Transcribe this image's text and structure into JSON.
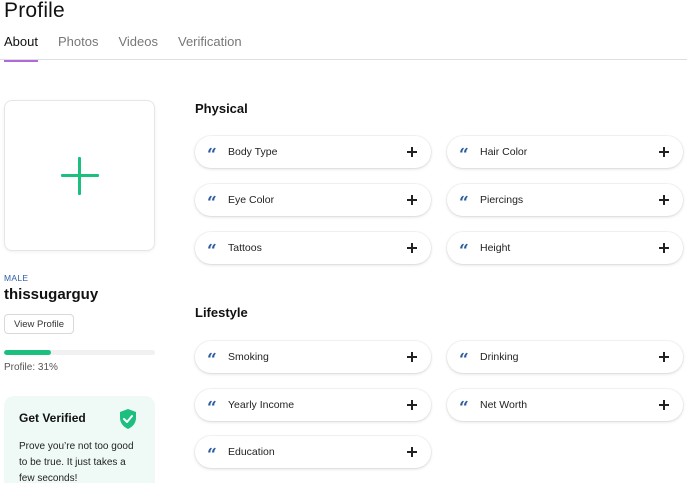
{
  "page": {
    "title": "Profile"
  },
  "tabs": [
    {
      "label": "About",
      "active": true
    },
    {
      "label": "Photos",
      "active": false
    },
    {
      "label": "Videos",
      "active": false
    },
    {
      "label": "Verification",
      "active": false
    }
  ],
  "profile": {
    "gender": "MALE",
    "username": "thissugarguy",
    "view_profile_label": "View Profile",
    "progress_label": "Profile: 31%",
    "progress_value": 0.31,
    "accent_color": "#1dbf7f"
  },
  "verify": {
    "title": "Get Verified",
    "text": "Prove you’re not too good to be true. It just takes a few seconds!",
    "icon": "shield-check-icon"
  },
  "sections": {
    "physical": {
      "title": "Physical",
      "items": [
        "Body Type",
        "Hair Color",
        "Eye Color",
        "Piercings",
        "Tattoos",
        "Height"
      ]
    },
    "lifestyle": {
      "title": "Lifestyle",
      "items": [
        "Smoking",
        "Drinking",
        "Yearly Income",
        "Net Worth",
        "Education"
      ]
    }
  },
  "icons": {
    "quote": "quote-icon",
    "add": "plus-icon"
  },
  "colors": {
    "tab_underline": "#b06ad9",
    "quote": "#2c5aa0",
    "verify_bg": "#effaf6"
  }
}
